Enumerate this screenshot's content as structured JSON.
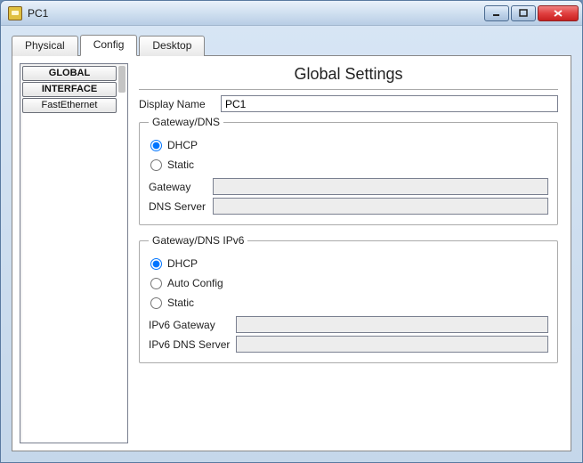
{
  "window": {
    "title": "PC1"
  },
  "tabs": {
    "physical": "Physical",
    "config": "Config",
    "desktop": "Desktop",
    "active": "config"
  },
  "sidebar": {
    "global": "GLOBAL",
    "interface": "INTERFACE",
    "fastethernet": "FastEthernet"
  },
  "page": {
    "title": "Global Settings",
    "display_name_label": "Display Name",
    "display_name": "PC1"
  },
  "gateway": {
    "legend": "Gateway/DNS",
    "dhcp": "DHCP",
    "static": "Static",
    "selected": "dhcp",
    "gateway_label": "Gateway",
    "gateway_value": "",
    "dns_label": "DNS Server",
    "dns_value": ""
  },
  "gateway6": {
    "legend": "Gateway/DNS IPv6",
    "dhcp": "DHCP",
    "auto": "Auto Config",
    "static": "Static",
    "selected": "dhcp",
    "gateway_label": "IPv6 Gateway",
    "gateway_value": "",
    "dns_label": "IPv6 DNS Server",
    "dns_value": ""
  }
}
